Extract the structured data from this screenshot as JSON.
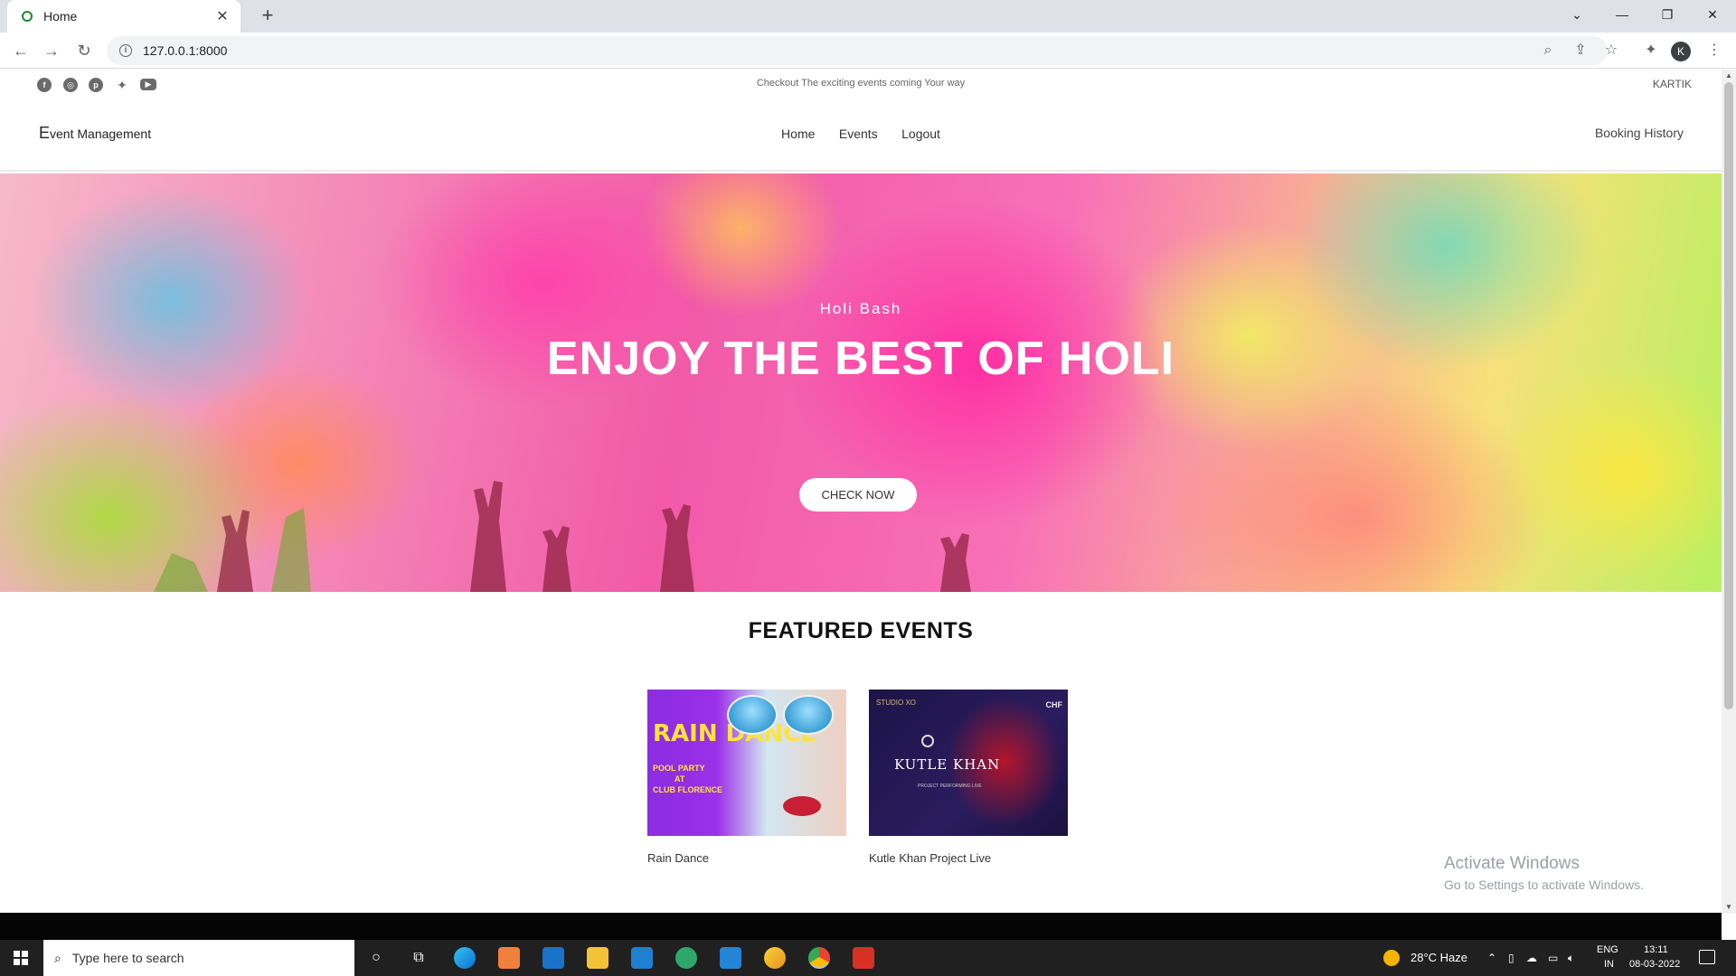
{
  "browser": {
    "tab_title": "Home",
    "url": "127.0.0.1:8000"
  },
  "site": {
    "social_icons": [
      "facebook-icon",
      "instagram-icon",
      "pinterest-icon",
      "twitter-icon",
      "youtube-icon"
    ],
    "tagline": "Checkout The exciting events coming Your way",
    "username": "KARTIK",
    "brand_initial": "E",
    "brand_rest": "vent Management",
    "nav": [
      "Home",
      "Events",
      "Logout"
    ],
    "booking_history": "Booking History"
  },
  "hero": {
    "subtitle": "Holi Bash",
    "title": "ENJOY THE BEST OF HOLI",
    "button": "CHECK NOW"
  },
  "featured": {
    "title": "FEATURED EVENTS",
    "events": [
      {
        "name": "Rain Dance",
        "poster_headline": "RAIN DANCE",
        "poster_lines": [
          "POOL PARTY",
          "AT",
          "CLUB FLORENCE"
        ]
      },
      {
        "name": "Kutle Khan Project Live",
        "poster_headline": "KUTLE KHAN",
        "poster_sub": "PROJECT PERFORMING LIVE",
        "poster_tag": "CHF",
        "poster_logo": "STUDIO XO"
      }
    ]
  },
  "watermark": {
    "line1": "Activate Windows",
    "line2": "Go to Settings to activate Windows."
  },
  "taskbar": {
    "search_placeholder": "Type here to search",
    "weather": "28°C  Haze",
    "lang1": "ENG",
    "lang2": "IN",
    "time": "13:11",
    "date": "08-03-2022"
  }
}
